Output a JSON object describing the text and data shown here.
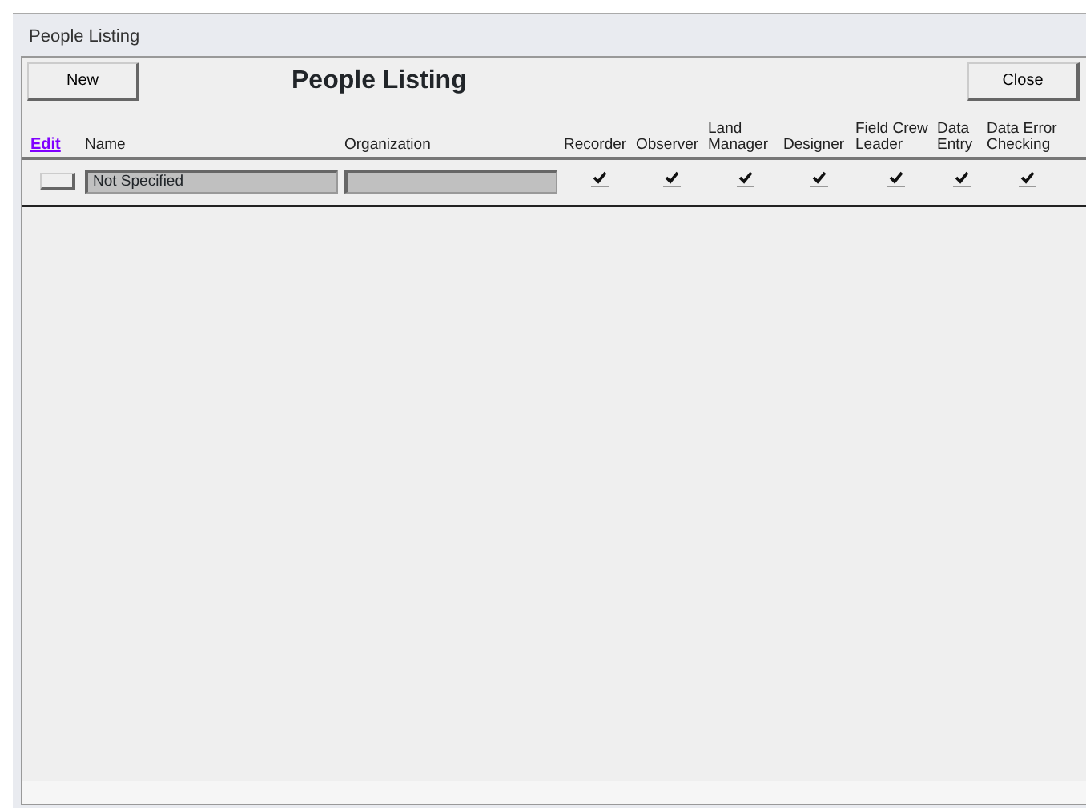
{
  "window": {
    "title": "People Listing"
  },
  "form": {
    "title": "People Listing",
    "new_button": "New",
    "close_button": "Close"
  },
  "columns": [
    "Edit",
    "Name",
    "Organization",
    "Recorder",
    "Observer",
    "Land Manager",
    "Designer",
    "Field Crew Leader",
    "Data Entry",
    "Data Error Checking"
  ],
  "rows": [
    {
      "name": "Not Specified",
      "roles": [
        {
          "checked": true
        },
        {
          "checked": true
        },
        {
          "checked": true
        },
        {
          "checked": true
        },
        {
          "checked": true
        },
        {
          "checked": true
        },
        {
          "checked": true
        }
      ]
    }
  ]
}
